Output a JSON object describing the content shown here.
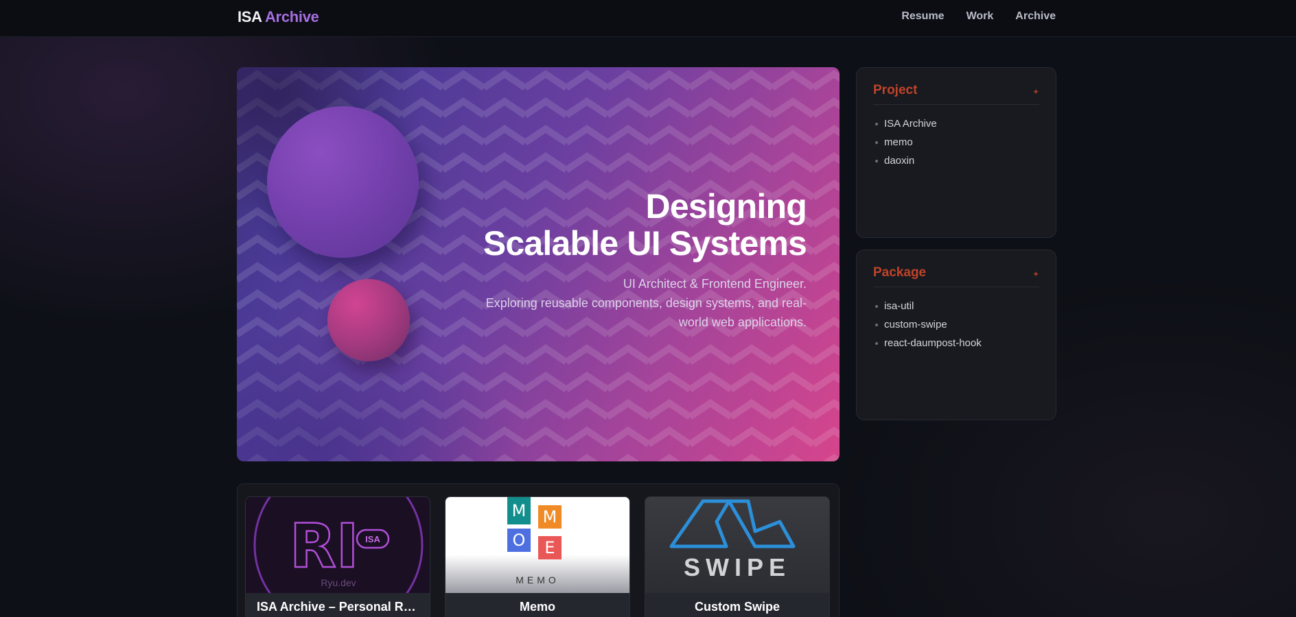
{
  "brand": {
    "part1": "ISA",
    "part2": "Archive"
  },
  "nav": {
    "items": [
      "Resume",
      "Work",
      "Archive"
    ]
  },
  "hero": {
    "title_line1": "Designing",
    "title_line2": "Scalable UI Systems",
    "subtitle_line1": "UI Architect & Frontend Engineer.",
    "subtitle_line2": "Exploring reusable components, design systems, and real-world web applications."
  },
  "panels": {
    "project": {
      "title": "Project",
      "items": [
        "ISA Archive",
        "memo",
        "daoxin"
      ]
    },
    "package": {
      "title": "Package",
      "items": [
        "isa-util",
        "custom-swipe",
        "react-daumpost-hook"
      ]
    }
  },
  "cards": [
    {
      "title": "ISA Archive – Personal Re…",
      "thumb": {
        "mark": "RI",
        "tag": "ISA",
        "caption": "Ryu.dev"
      }
    },
    {
      "title": "Memo",
      "thumb": {
        "tiles": [
          "M",
          "M",
          "O",
          "E"
        ],
        "caption": "MEMO"
      }
    },
    {
      "title": "Custom Swipe",
      "thumb": {
        "caption": "SWIPE"
      }
    }
  ],
  "colors": {
    "accent": "#a66fe0",
    "panel_title": "#c0432a",
    "hero_start": "#3b2f78",
    "hero_end": "#d6458c"
  }
}
